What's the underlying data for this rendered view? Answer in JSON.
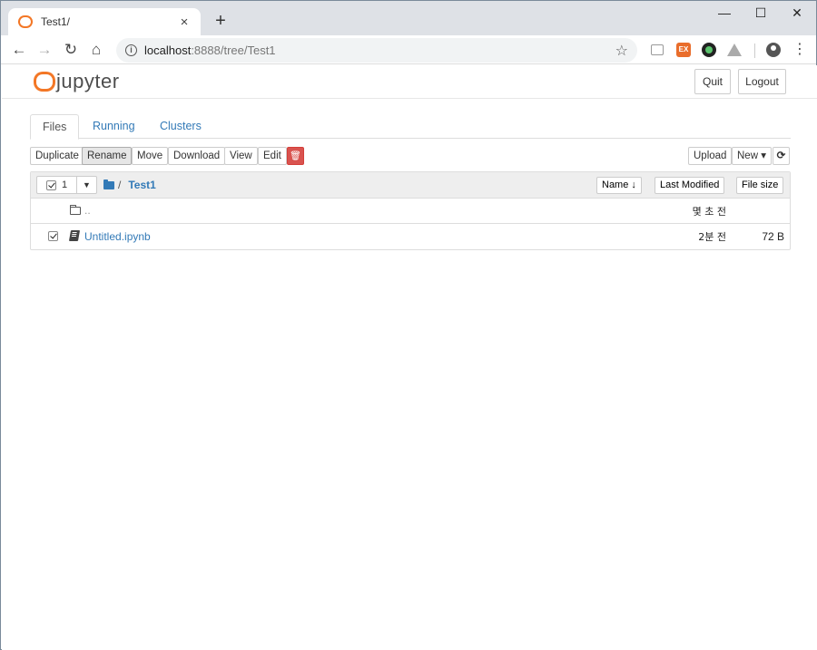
{
  "browser": {
    "tab_title": "Test1/",
    "tab_close": "×",
    "new_tab": "+",
    "window_controls": {
      "minimize": "—",
      "maximize": "☐",
      "close": "✕"
    },
    "nav": {
      "back": "←",
      "forward": "→",
      "reload": "↻",
      "home": "⌂"
    },
    "url_host": "localhost",
    "url_path": ":8888/tree/Test1",
    "star": "☆",
    "menu": "⋮",
    "ext_label": "EX"
  },
  "jupyter": {
    "logo_text": "jupyter",
    "quit_label": "Quit",
    "logout_label": "Logout",
    "tabs": [
      {
        "label": "Files",
        "active": true
      },
      {
        "label": "Running",
        "active": false
      },
      {
        "label": "Clusters",
        "active": false
      }
    ],
    "actions": {
      "duplicate": "Duplicate",
      "rename": "Rename",
      "move": "Move",
      "download": "Download",
      "view": "View",
      "edit": "Edit",
      "delete_icon": "🗑",
      "upload": "Upload",
      "new": "New ▾",
      "refresh": "⟳"
    },
    "list_header": {
      "selected_count": "1",
      "select_caret": "▼",
      "breadcrumb_slash": "/",
      "breadcrumb_folder": "Test1",
      "sort_name": "Name ↓",
      "sort_modified": "Last Modified",
      "sort_size": "File size"
    },
    "rows": [
      {
        "name": "..",
        "modified": "몇 초 전",
        "size": "",
        "type": "parent"
      },
      {
        "name": "Untitled.ipynb",
        "modified": "2분 전",
        "size": "72 B",
        "type": "notebook",
        "checked": true
      }
    ],
    "colors": {
      "accent": "#337ab7",
      "brand": "#f37726",
      "danger": "#d9534f"
    }
  }
}
